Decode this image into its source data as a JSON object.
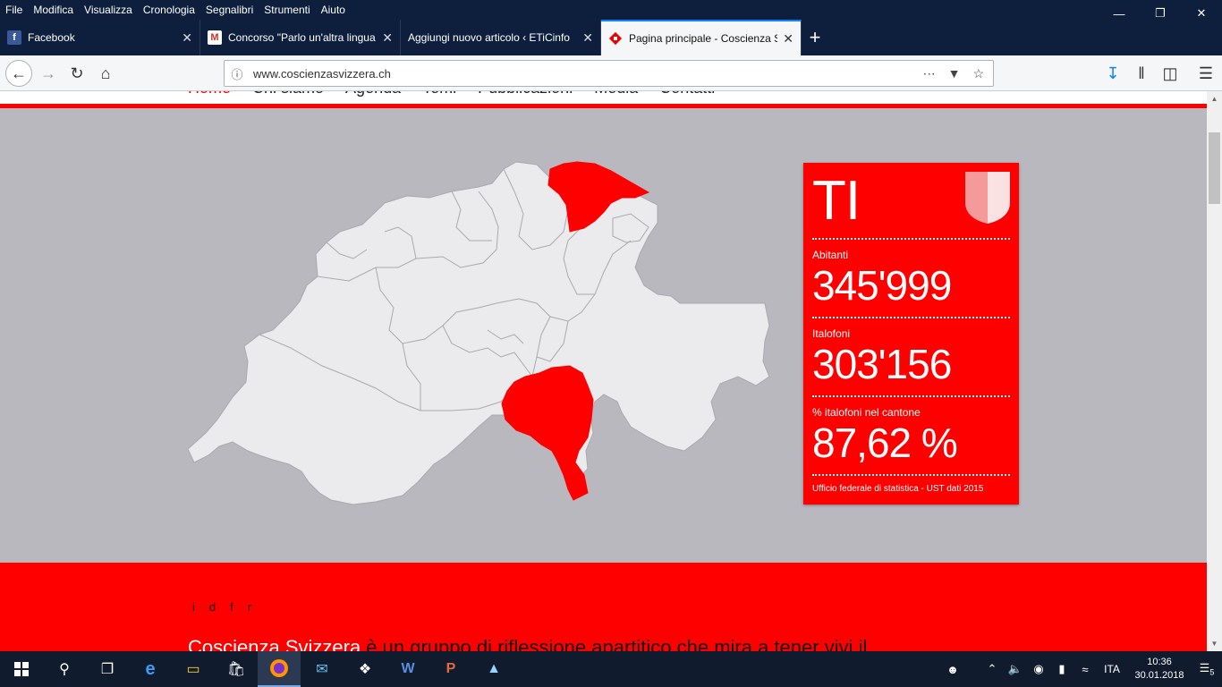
{
  "menubar": {
    "items": [
      "File",
      "Modifica",
      "Visualizza",
      "Cronologia",
      "Segnalibri",
      "Strumenti",
      "Aiuto"
    ]
  },
  "tabs": [
    {
      "title": "Facebook",
      "icon": "facebook-icon"
    },
    {
      "title": "Concorso \"Parlo un'altra lingua",
      "icon": "gmail-icon"
    },
    {
      "title": "Aggiungi nuovo articolo ‹ ETiCinfo",
      "icon": "none"
    },
    {
      "title": "Pagina principale - Coscienza S",
      "icon": "coscienza-icon",
      "active": true
    }
  ],
  "urlbar": {
    "url": "www.coscienzasvizzera.ch"
  },
  "site_nav": {
    "items": [
      "Home",
      "Chi siamo",
      "Agenda",
      "Temi",
      "Pubblicazioni",
      "Media",
      "Contatti"
    ]
  },
  "info_card": {
    "code": "TI",
    "abitanti_label": "Abitanti",
    "abitanti_value": "345'999",
    "italofoni_label": "Italofoni",
    "italofoni_value": "303'156",
    "percent_label": "% italofoni nel cantone",
    "percent_value": "87,62 %",
    "source": "Ufficio federale di statistica - UST dati 2015"
  },
  "languages": [
    "i",
    "d",
    "f",
    "r"
  ],
  "intro": {
    "brand": "Coscienza Svizzera",
    "text": " è un gruppo di riflessione apartitico che mira a tener vivi il"
  },
  "taskbar": {
    "lang": "ITA",
    "time": "10:36",
    "date": "30.01.2018",
    "notifications": "5"
  },
  "colors": {
    "accent_red": "#ff0000",
    "map_bg": "#b8b8be",
    "canton_fill": "#ebebed",
    "highlight": "#ff0000"
  }
}
